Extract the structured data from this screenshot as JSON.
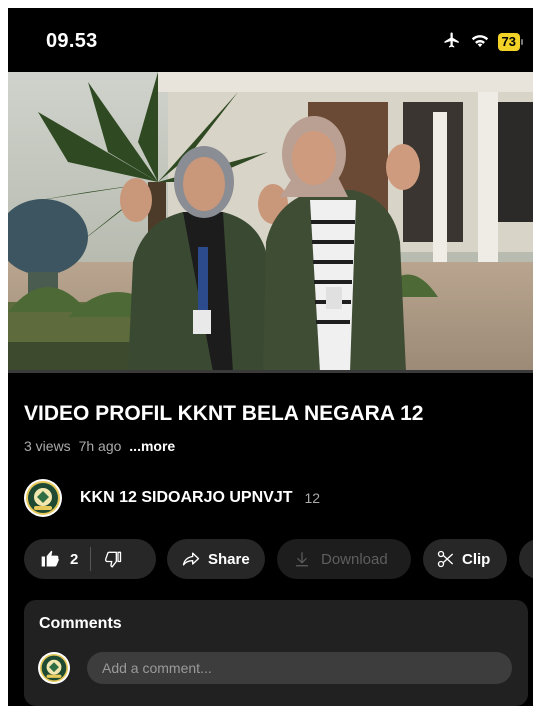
{
  "status_bar": {
    "time": "09.53",
    "battery_level": "73",
    "icons": [
      "airplane-icon",
      "wifi-icon",
      "battery-icon"
    ],
    "battery_color": "#f2d226"
  },
  "video": {
    "title": "VIDEO PROFIL KKNT BELA NEGARA 12",
    "views": "3 views",
    "age": "7h ago",
    "more_label": "...more"
  },
  "channel": {
    "name": "KKN 12 SIDOARJO UPNVJT",
    "subscriber_count": "12"
  },
  "actions": {
    "like_count": "2",
    "share_label": "Share",
    "download_label": "Download",
    "clip_label": "Clip"
  },
  "comments": {
    "title": "Comments",
    "placeholder": "Add a comment..."
  },
  "colors": {
    "background": "#000000",
    "pill": "#272727",
    "panel": "#212121",
    "muted_text": "#aaaaaa"
  }
}
